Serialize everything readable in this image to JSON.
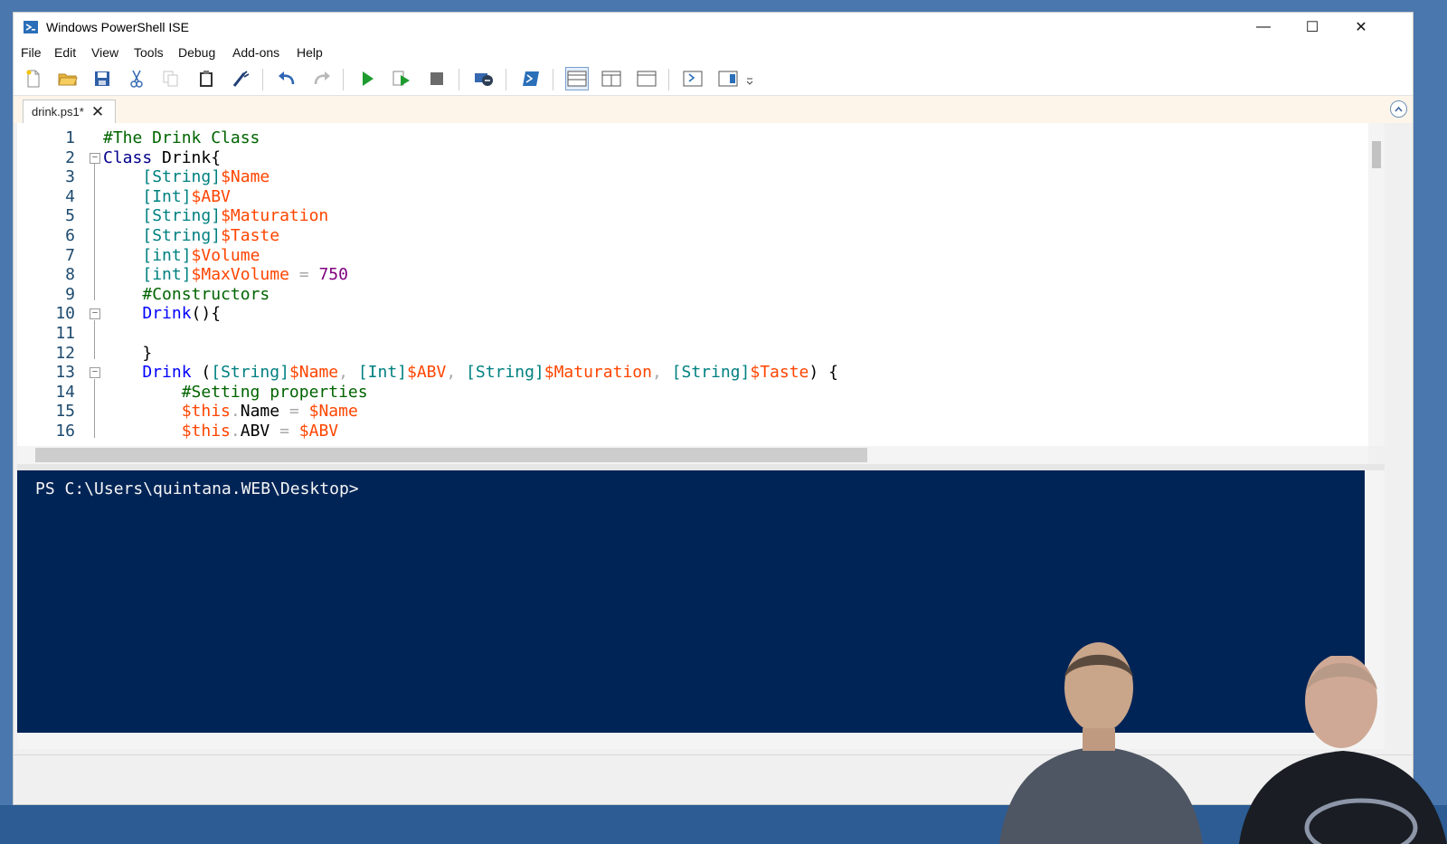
{
  "window": {
    "title": "Windows PowerShell ISE",
    "controls": {
      "minimize": "—",
      "maximize": "☐",
      "close": "✕"
    }
  },
  "menu": [
    "File",
    "Edit",
    "View",
    "Tools",
    "Debug",
    "Add-ons",
    "Help"
  ],
  "toolbar": {
    "icons": [
      "new-file-icon",
      "open-folder-icon",
      "save-icon",
      "cut-icon",
      "copy-icon",
      "paste-icon",
      "clear-console-icon",
      "undo-icon",
      "redo-icon",
      "run-script-icon",
      "run-selection-icon",
      "stop-icon",
      "remote-powershell-icon",
      "powershell-console-icon",
      "show-script-top-icon",
      "show-script-right-icon",
      "show-script-maximized-icon",
      "show-command-window-icon",
      "show-command-addon-icon"
    ]
  },
  "tab": {
    "name": "drink.ps1*",
    "close": "✕"
  },
  "editor": {
    "line_numbers": [
      "1",
      "2",
      "3",
      "4",
      "5",
      "6",
      "7",
      "8",
      "9",
      "10",
      "11",
      "12",
      "13",
      "14",
      "15",
      "16"
    ],
    "lines": [
      [
        {
          "t": "#The Drink Class",
          "c": "comment"
        }
      ],
      [
        {
          "t": "Class ",
          "c": "kw"
        },
        {
          "t": "Drink",
          "c": "plain"
        },
        {
          "t": "{",
          "c": "plain"
        }
      ],
      [
        {
          "t": "    ",
          "c": "plain"
        },
        {
          "t": "[String]",
          "c": "type"
        },
        {
          "t": "$Name",
          "c": "var"
        }
      ],
      [
        {
          "t": "    ",
          "c": "plain"
        },
        {
          "t": "[Int]",
          "c": "type"
        },
        {
          "t": "$ABV",
          "c": "var"
        }
      ],
      [
        {
          "t": "    ",
          "c": "plain"
        },
        {
          "t": "[String]",
          "c": "type"
        },
        {
          "t": "$Maturation",
          "c": "var"
        }
      ],
      [
        {
          "t": "    ",
          "c": "plain"
        },
        {
          "t": "[String]",
          "c": "type"
        },
        {
          "t": "$Taste",
          "c": "var"
        }
      ],
      [
        {
          "t": "    ",
          "c": "plain"
        },
        {
          "t": "[int]",
          "c": "type"
        },
        {
          "t": "$Volume",
          "c": "var"
        }
      ],
      [
        {
          "t": "    ",
          "c": "plain"
        },
        {
          "t": "[int]",
          "c": "type"
        },
        {
          "t": "$MaxVolume",
          "c": "var"
        },
        {
          "t": " = ",
          "c": "op"
        },
        {
          "t": "750",
          "c": "num"
        }
      ],
      [
        {
          "t": "    ",
          "c": "plain"
        },
        {
          "t": "#Constructors",
          "c": "comment"
        }
      ],
      [
        {
          "t": "    ",
          "c": "plain"
        },
        {
          "t": "Drink",
          "c": "cmd"
        },
        {
          "t": "(){",
          "c": "plain"
        }
      ],
      [
        {
          "t": "",
          "c": "plain"
        }
      ],
      [
        {
          "t": "    ",
          "c": "plain"
        },
        {
          "t": "}",
          "c": "plain"
        }
      ],
      [
        {
          "t": "    ",
          "c": "plain"
        },
        {
          "t": "Drink",
          "c": "cmd"
        },
        {
          "t": " (",
          "c": "plain"
        },
        {
          "t": "[String]",
          "c": "type"
        },
        {
          "t": "$Name",
          "c": "var"
        },
        {
          "t": ", ",
          "c": "op"
        },
        {
          "t": "[Int]",
          "c": "type"
        },
        {
          "t": "$ABV",
          "c": "var"
        },
        {
          "t": ", ",
          "c": "op"
        },
        {
          "t": "[String]",
          "c": "type"
        },
        {
          "t": "$Maturation",
          "c": "var"
        },
        {
          "t": ", ",
          "c": "op"
        },
        {
          "t": "[String]",
          "c": "type"
        },
        {
          "t": "$Taste",
          "c": "var"
        },
        {
          "t": ") {",
          "c": "plain"
        }
      ],
      [
        {
          "t": "        ",
          "c": "plain"
        },
        {
          "t": "#Setting properties",
          "c": "comment"
        }
      ],
      [
        {
          "t": "        ",
          "c": "plain"
        },
        {
          "t": "$this",
          "c": "var"
        },
        {
          "t": ".",
          "c": "op"
        },
        {
          "t": "Name",
          "c": "member"
        },
        {
          "t": " = ",
          "c": "op"
        },
        {
          "t": "$Name",
          "c": "var"
        }
      ],
      [
        {
          "t": "        ",
          "c": "plain"
        },
        {
          "t": "$this",
          "c": "var"
        },
        {
          "t": ".",
          "c": "op"
        },
        {
          "t": "ABV",
          "c": "member"
        },
        {
          "t": " = ",
          "c": "op"
        },
        {
          "t": "$ABV",
          "c": "var"
        }
      ]
    ],
    "fold_markers": [
      "−",
      "−",
      "−"
    ]
  },
  "console": {
    "prompt": "PS C:\\Users\\quintana.WEB\\Desktop>"
  },
  "colors": {
    "console_bg": "#012456",
    "comment": "#006400",
    "keyword": "#00008b",
    "type": "#008080",
    "variable": "#ff4500",
    "number": "#800080",
    "tab_strip": "#fdf5ea"
  }
}
